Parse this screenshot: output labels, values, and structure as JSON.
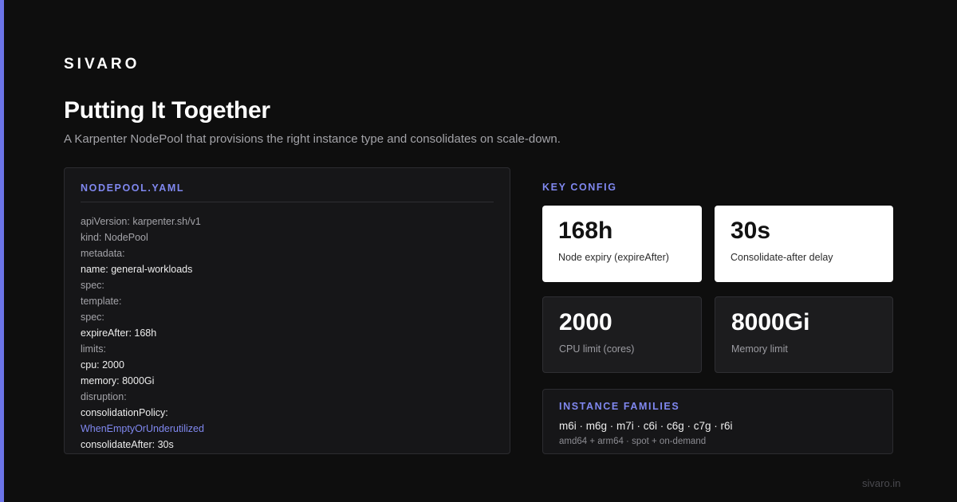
{
  "brand": "SIVARO",
  "title": "Putting It Together",
  "subtitle": "A Karpenter NodePool that provisions the right instance type and consolidates on scale-down.",
  "yaml": {
    "title": "NODEPOOL.YAML",
    "lines": [
      {
        "text": "apiVersion: karpenter.sh/v1",
        "tone": "dim"
      },
      {
        "text": "kind: NodePool",
        "tone": "dim"
      },
      {
        "text": "metadata:",
        "tone": "dim"
      },
      {
        "text": "name: general-workloads",
        "tone": "white"
      },
      {
        "text": "spec:",
        "tone": "dim"
      },
      {
        "text": "template:",
        "tone": "dim"
      },
      {
        "text": "spec:",
        "tone": "dim"
      },
      {
        "text": "expireAfter: 168h",
        "tone": "white"
      },
      {
        "text": "limits:",
        "tone": "dim"
      },
      {
        "text": "cpu: 2000",
        "tone": "white"
      },
      {
        "text": "memory: 8000Gi",
        "tone": "white"
      },
      {
        "text": "disruption:",
        "tone": "dim"
      },
      {
        "text": "consolidationPolicy:",
        "tone": "white"
      },
      {
        "text": "WhenEmptyOrUnderutilized",
        "tone": "accent"
      },
      {
        "text": "consolidateAfter: 30s",
        "tone": "white"
      }
    ]
  },
  "key_config": {
    "label": "KEY CONFIG",
    "stats": [
      {
        "value": "168h",
        "label": "Node expiry (expireAfter)"
      },
      {
        "value": "30s",
        "label": "Consolidate-after delay"
      },
      {
        "value": "2000",
        "label": "CPU limit (cores)"
      },
      {
        "value": "8000Gi",
        "label": "Memory limit"
      }
    ]
  },
  "families": {
    "title": "INSTANCE FAMILIES",
    "list": "m6i · m6g · m7i · c6i · c6g · c7g · r6i",
    "note": "amd64 + arm64 · spot + on-demand"
  },
  "footer": "sivaro.in",
  "colors": {
    "background": "#0e0e0e",
    "accent": "#8088f0",
    "accent_bar": "#6c74e8"
  }
}
